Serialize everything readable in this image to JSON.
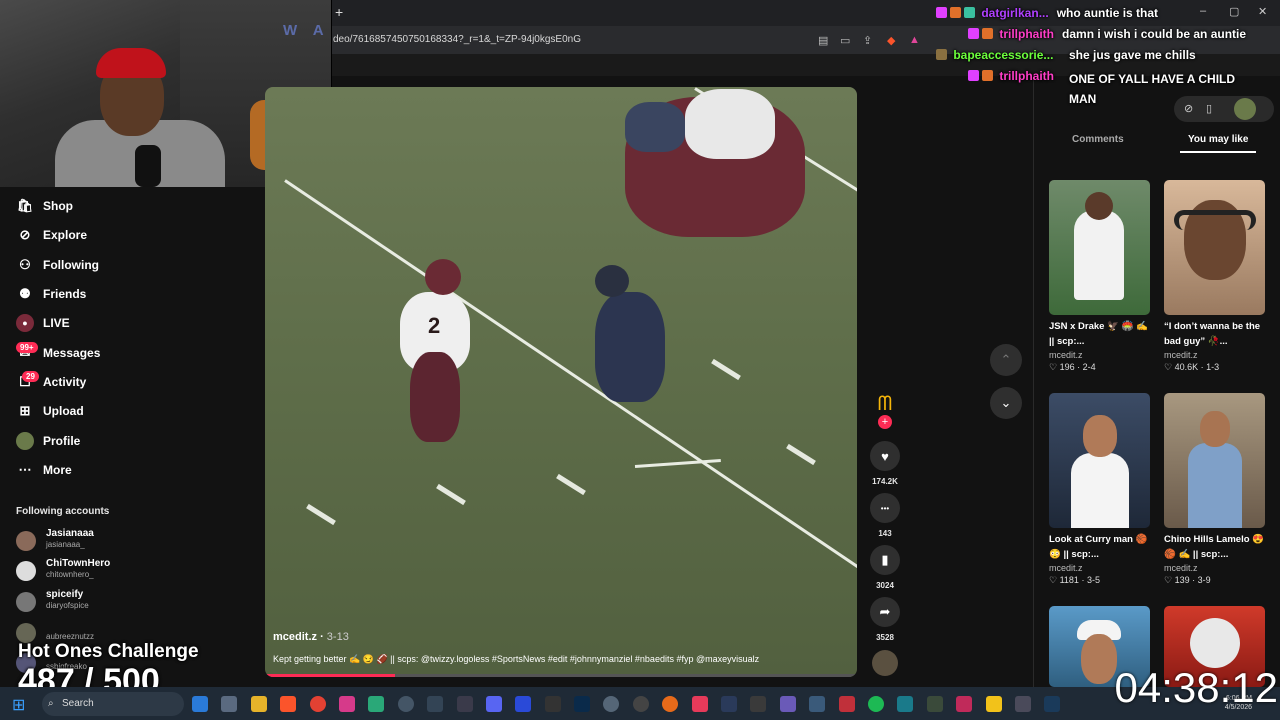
{
  "browser": {
    "url": "deo/7616857450750168334?_r=1&_t=ZP-94j0kgsE0nG",
    "new_tab": "+",
    "win_min": "–",
    "win_max": "▢",
    "win_close": "✕"
  },
  "webcam": {
    "letters": "W A"
  },
  "nav": [
    {
      "label": "Shop",
      "icon": "shop-icon"
    },
    {
      "label": "Explore",
      "icon": "compass-icon"
    },
    {
      "label": "Following",
      "icon": "following-icon"
    },
    {
      "label": "Friends",
      "icon": "friends-icon"
    },
    {
      "label": "LIVE",
      "icon": "live-icon"
    },
    {
      "label": "Messages",
      "icon": "messages-icon",
      "badge": "99+"
    },
    {
      "label": "Activity",
      "icon": "activity-icon",
      "badge": "29"
    },
    {
      "label": "Upload",
      "icon": "upload-icon"
    },
    {
      "label": "Profile",
      "icon": "profile-avatar"
    },
    {
      "label": "More",
      "icon": "more-icon"
    }
  ],
  "following": {
    "heading": "Following accounts",
    "accounts": [
      {
        "name": "Jasianaaa",
        "handle": "jasianaaa_"
      },
      {
        "name": "ChiTownHero",
        "handle": "chitownhero_"
      },
      {
        "name": "spiceify",
        "handle": "diaryofspice"
      },
      {
        "name": "",
        "handle": "aubreeznutzz"
      },
      {
        "name": "",
        "handle": "ssbigfreako"
      }
    ]
  },
  "video": {
    "author": "mcedit.z",
    "date": "3-13",
    "caption": "Kept getting better ✍️ 😏 🏈 || scps: @twizzy.logoless #SportsNews #edit #johnnymanziel #nbaedits #fyp @maxeyvisualz",
    "progress": 0.22,
    "jersey": "2"
  },
  "actions": [
    {
      "name": "like",
      "icon": "heart-icon",
      "glyph": "♥",
      "count": "174.2K"
    },
    {
      "name": "comment",
      "icon": "comment-icon",
      "glyph": "•••",
      "count": "143"
    },
    {
      "name": "bookmark",
      "icon": "bookmark-icon",
      "glyph": "▮",
      "count": "3024"
    },
    {
      "name": "share",
      "icon": "share-icon",
      "glyph": "➦",
      "count": "3528"
    }
  ],
  "arrows": {
    "up": "⌃",
    "down": "⌄"
  },
  "right_panel": {
    "tabs": [
      "Comments",
      "You may like"
    ],
    "active_tab": "You may like",
    "cards": [
      {
        "title": "JSN x Drake 🦅 🏟️ ✍️ || scp:...",
        "author": "mcedit.z",
        "likes": "196",
        "date": "2-4",
        "color": "#3e6a3a"
      },
      {
        "title": "“I don’t wanna be the bad guy” 🥀...",
        "author": "mcedit.z",
        "likes": "40.6K",
        "date": "1-3",
        "color": "#c89672"
      },
      {
        "title": "Look at Curry man 🏀 😳 || scp:...",
        "author": "mcedit.z",
        "likes": "1181",
        "date": "3-5",
        "color": "#2c3f5a"
      },
      {
        "title": "Chino Hills Lamelo 😍 🏀 ✍️ || scp:...",
        "author": "mcedit.z",
        "likes": "139",
        "date": "3-9",
        "color": "#8a7a6a"
      },
      {
        "title": "",
        "author": "",
        "likes": "",
        "date": "",
        "color": "#2f7fb0"
      },
      {
        "title": "",
        "author": "",
        "likes": "",
        "date": "",
        "color": "#c0281e"
      }
    ]
  },
  "chat": [
    {
      "user": "datgirlkan...",
      "msg": "who auntie is that",
      "color": "#b040ff"
    },
    {
      "user": "trillphaith",
      "msg": "damn i wish i could be an auntie",
      "color": "#ff3ec8"
    },
    {
      "user": "",
      "msg": "she jus gave me chills",
      "color": "#ffffff"
    },
    {
      "user": "bapeaccessorie...",
      "msg": "",
      "color": "#6cff3c"
    },
    {
      "user": "trillphaith",
      "msg": "ONE OF YALL HAVE A CHILD MAN",
      "color": "#ff3ec8"
    }
  ],
  "overlay": {
    "challenge": "Hot Ones Challenge",
    "counter": "487 / 500",
    "timer": "04:38:12"
  },
  "taskbar": {
    "search": "Search",
    "time": "6:06 PM",
    "date": "4/5/2026"
  }
}
